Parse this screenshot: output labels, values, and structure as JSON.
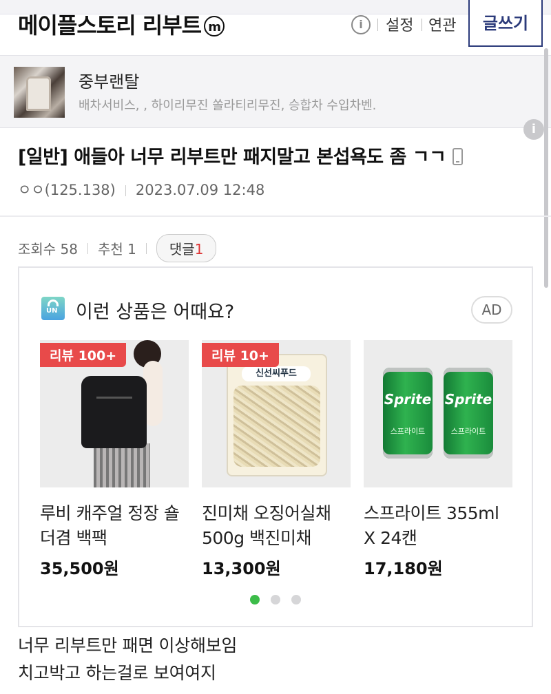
{
  "header": {
    "gallery_title": "메이플스토리 리부트",
    "minor_badge": "m",
    "settings": "설정",
    "related": "연관",
    "write": "글쓰기"
  },
  "ad_banner": {
    "name": "중부랜탈",
    "description": "배차서비스, , 하이리무진 쏠라티리무진, 승합차 수입차벤."
  },
  "post": {
    "title": "[일반] 애들아 너무 리부트만 패지말고 본섭욕도 좀 ㄱㄱ",
    "author": "ㅇㅇ(125.138)",
    "date": "2023.07.09 12:48",
    "views_label": "조회수 58",
    "recommend_label": "추천 1",
    "comments_label": "댓글",
    "comments_count": "1",
    "body": [
      "너무 리부트만 패면 이상해보임",
      "치고박고 하는걸로 보여여지"
    ]
  },
  "recommend": {
    "title": "이런 상품은 어때요?",
    "ad_label": "AD",
    "products": [
      {
        "badge": "리뷰 100+",
        "name": "루비 캐주얼 정장 숄더겸 백팩",
        "price": "35,500원"
      },
      {
        "badge": "리뷰 10+",
        "name": "진미채 오징어실채 500g 백진미채",
        "price": "13,300원",
        "package_text": "신선씨푸드"
      },
      {
        "badge": "",
        "name": "스프라이트 355ml X 24캔",
        "price": "17,180원",
        "can_brand": "Sprite",
        "can_sub": "스프라이트"
      }
    ],
    "page_indicator": {
      "current": 1,
      "total": 3
    }
  },
  "colors": {
    "accent_navy": "#2b3a7a",
    "badge_red": "#e84a4a",
    "dot_active": "#3cbc49"
  }
}
